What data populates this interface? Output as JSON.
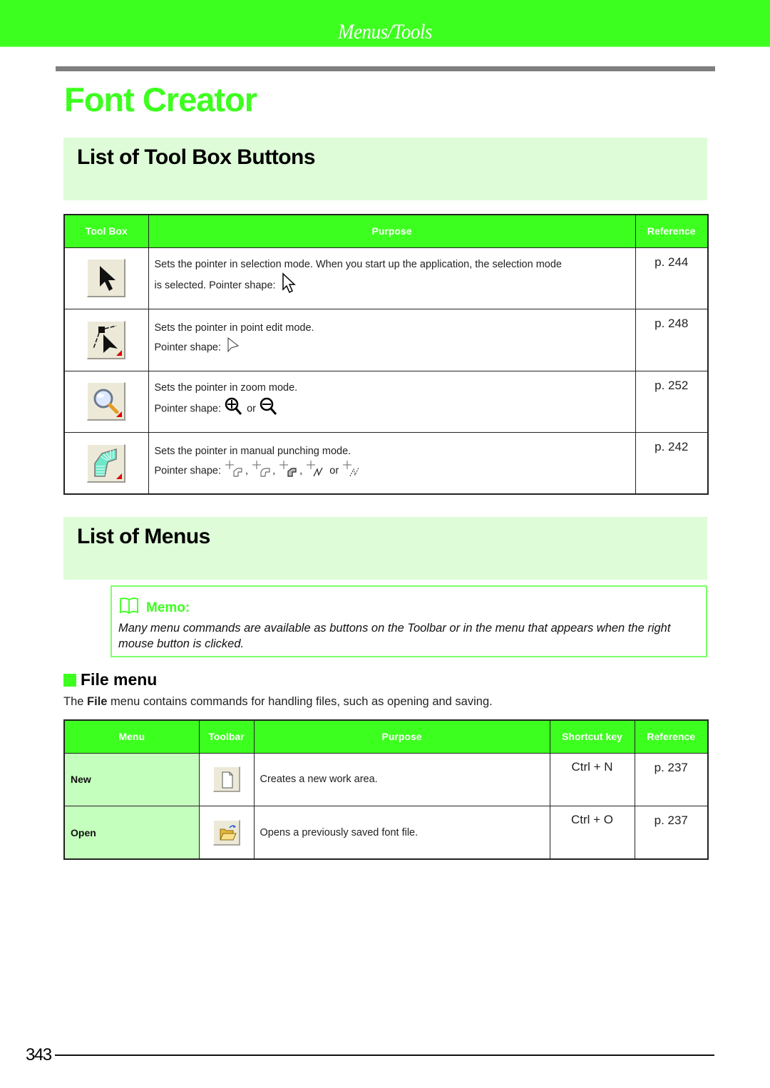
{
  "header": {
    "section": "Menus/Tools",
    "page_title": "Font Creator"
  },
  "colors": {
    "accent_green": "#3dff1f",
    "band_green": "#defcd8",
    "menu_cell_green": "#c5ffbd",
    "rule_gray": "#7f7f7f"
  },
  "toolbox_section": {
    "title": "List of Tool Box Buttons",
    "table": {
      "headers": [
        "Tool Box",
        "Purpose",
        "Reference"
      ],
      "rows": [
        {
          "icon": "select-arrow-icon",
          "purpose_line1": "Sets the pointer in selection mode. When you start up the application, the selection mode",
          "purpose_line2": "is selected. Pointer shape:",
          "pointer_shapes": [
            "arrow-pointer-icon"
          ],
          "reference": "p. 244"
        },
        {
          "icon": "point-edit-icon",
          "purpose_line1": "Sets the pointer in point edit mode.",
          "purpose_line2": "Pointer shape:",
          "pointer_shapes": [
            "hollow-arrow-pointer-icon"
          ],
          "reference": "p. 248"
        },
        {
          "icon": "magnifier-icon",
          "purpose_line1": "Sets the pointer in zoom mode.",
          "purpose_line2": "Pointer shape:",
          "pointer_shapes": [
            "zoom-in-pointer-icon",
            "zoom-out-pointer-icon"
          ],
          "conjunction": "or",
          "reference": "p. 252"
        },
        {
          "icon": "manual-punch-icon",
          "purpose_line1": "Sets the pointer in manual punching mode.",
          "purpose_line2": "Pointer shape:",
          "pointer_shapes": [
            "punch-pointer-1-icon",
            "punch-pointer-2-icon",
            "punch-pointer-3-icon",
            "punch-pointer-zigzag-icon",
            "punch-pointer-dotted-zigzag-icon"
          ],
          "separator": ",",
          "conjunction": "or",
          "reference": "p. 242"
        }
      ]
    }
  },
  "menus_section": {
    "title": "List of Menus",
    "memo": {
      "label": "Memo:",
      "icon": "book-icon",
      "text": "Many menu commands are available as buttons on the Toolbar or in the menu that appears when the right mouse button is clicked."
    },
    "file_menu": {
      "heading": "File menu",
      "intro_prefix": "The ",
      "intro_bold": "File",
      "intro_suffix": " menu contains commands for handling files, such as opening and saving.",
      "table": {
        "headers": [
          "Menu",
          "Toolbar",
          "Purpose",
          "Shortcut key",
          "Reference"
        ],
        "rows": [
          {
            "menu": "New",
            "toolbar_icon": "new-document-icon",
            "purpose": "Creates a new work area.",
            "shortcut": "Ctrl + N",
            "reference": "p. 237"
          },
          {
            "menu": "Open",
            "toolbar_icon": "open-folder-icon",
            "purpose": "Opens a previously saved font file.",
            "shortcut": "Ctrl + O",
            "reference": "p. 237"
          }
        ]
      }
    }
  },
  "footer": {
    "page_number": "343"
  }
}
